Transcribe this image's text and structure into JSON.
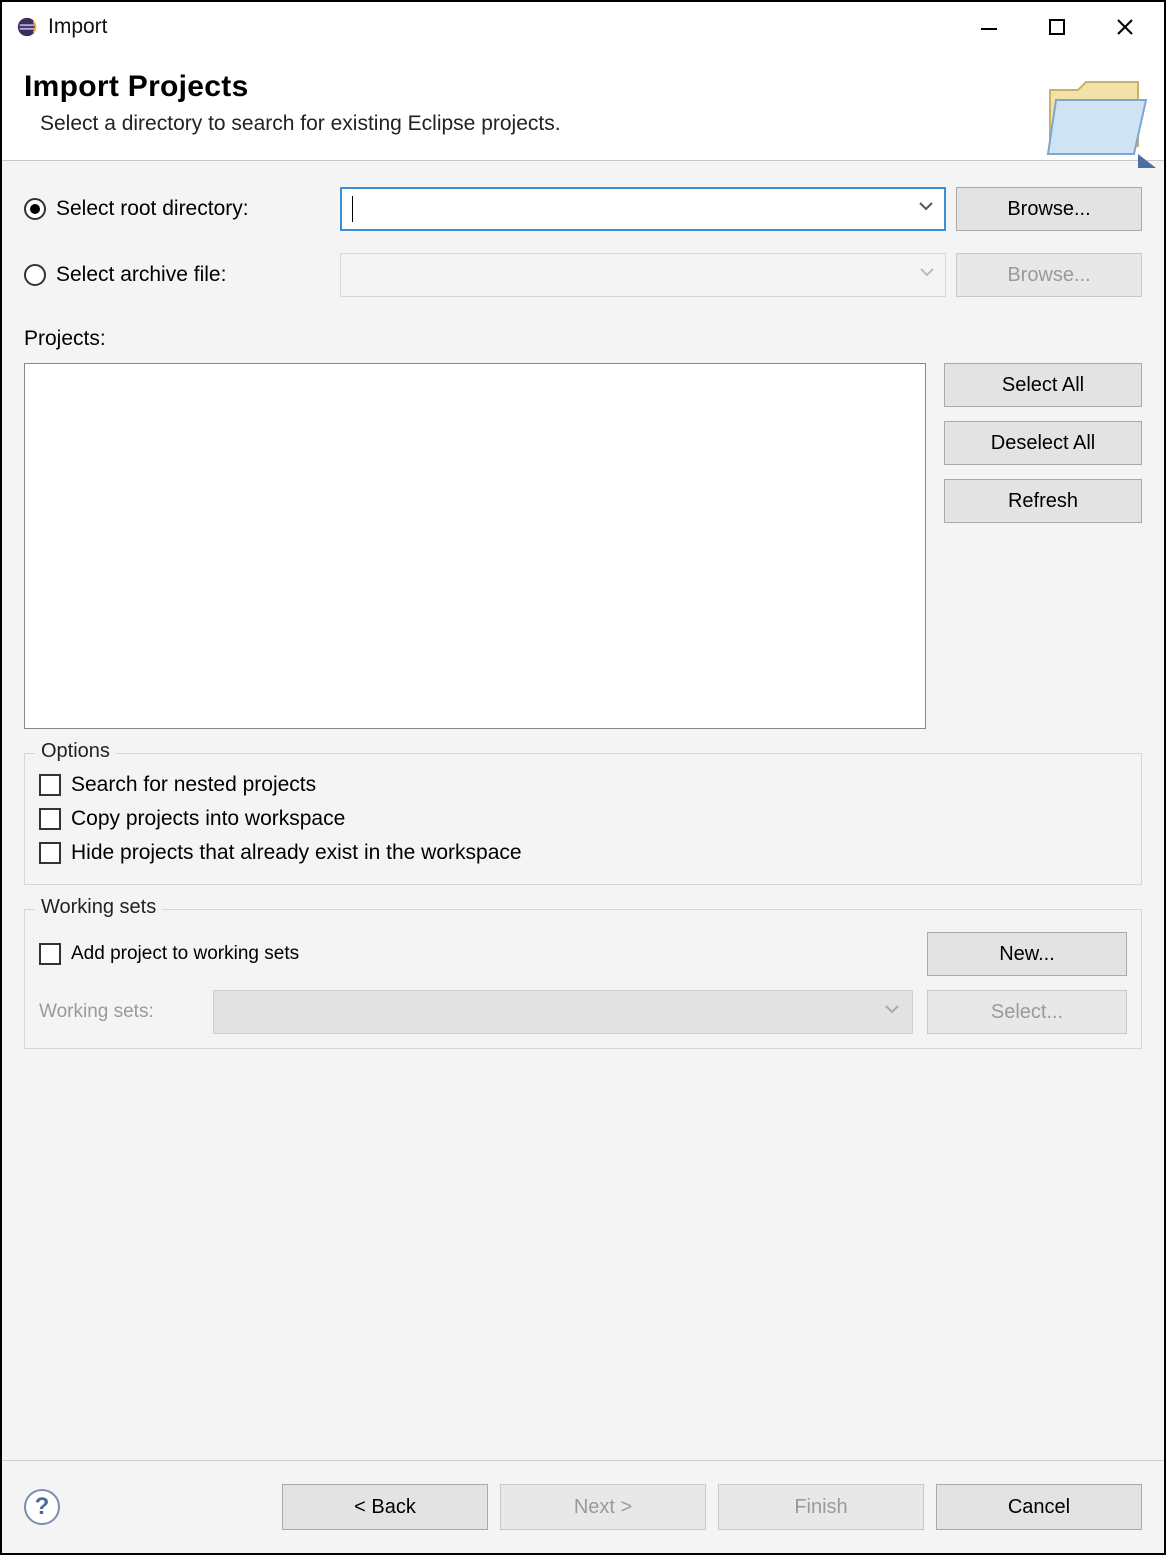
{
  "window": {
    "title": "Import"
  },
  "banner": {
    "heading": "Import Projects",
    "description": "Select a directory to search for existing Eclipse projects."
  },
  "source": {
    "root_radio_label": "Select root directory:",
    "root_value": "",
    "root_browse": "Browse...",
    "archive_radio_label": "Select archive file:",
    "archive_value": "",
    "archive_browse": "Browse..."
  },
  "projects": {
    "label": "Projects:",
    "select_all": "Select All",
    "deselect_all": "Deselect All",
    "refresh": "Refresh"
  },
  "options": {
    "group_title": "Options",
    "search_nested": "Search for nested projects",
    "copy_into_workspace": "Copy projects into workspace",
    "hide_existing": "Hide projects that already exist in the workspace"
  },
  "working_sets": {
    "group_title": "Working sets",
    "add_label": "Add project to working sets",
    "new_btn": "New...",
    "ws_label": "Working sets:",
    "ws_value": "",
    "select_btn": "Select..."
  },
  "footer": {
    "back": "< Back",
    "next": "Next >",
    "finish": "Finish",
    "cancel": "Cancel"
  }
}
